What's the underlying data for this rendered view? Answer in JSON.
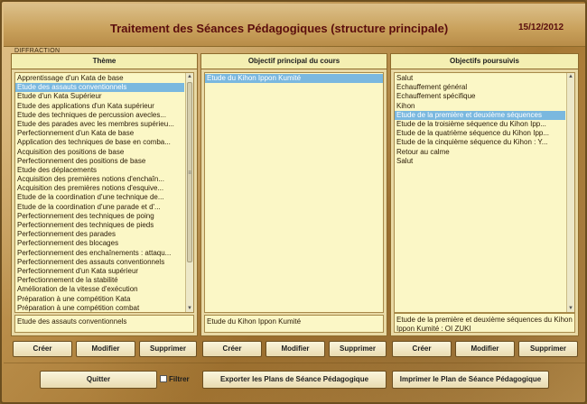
{
  "header": {
    "title": "Traitement des Séances Pédagogiques (structure principale)",
    "date": "15/12/2012",
    "section": "DIFFRACTION"
  },
  "panels": {
    "theme": {
      "header": "Thème",
      "items": [
        "Apprentissage d'un Kata de base",
        "Etude des assauts conventionnels",
        "Etude d'un Kata Supérieur",
        "Etude des applications d'un Kata supérieur",
        "Etude des techniques de percussion avecles...",
        "Etude des parades avec les membres supérieu...",
        "Perfectionnement d'un Kata de base",
        "Application des techniques de base en comba...",
        "Acquisition des positions de base",
        "Perfectionnement des positions de base",
        "Etude des déplacements",
        "Acquisition des premières notions d'enchaîn...",
        "Acquisition des premières notions d'esquive...",
        "Etude de la coordination d'une technique de...",
        "Etude de la coordination d'une parade et d'...",
        "Perfectionnement des techniques de poing",
        "Perfectionnement des techniques de pieds",
        "Perfectionnement des parades",
        "Perfectionnement des blocages",
        "Perfectionnement des enchaînements : attaqu...",
        "Perfectionnement des assauts conventionnels",
        "Perfectionnement d'un Kata supérieur",
        "Perfectionnement de la stabilité",
        "Amélioration de la vitesse d'exécution",
        "Préparation à une compétition Kata",
        "Préparation à une compétition combat"
      ],
      "selected_index": 1,
      "detail": "Etude des assauts conventionnels"
    },
    "objectif_principal": {
      "header": "Objectif principal du cours",
      "items": [
        "Etude du Kihon Ippon Kumité"
      ],
      "selected_index": 0,
      "detail": "Etude du Kihon Ippon Kumité"
    },
    "objectifs_poursuivis": {
      "header": "Objectifs poursuivis",
      "items": [
        "Salut",
        "Echauffement général",
        "Echauffement spécifique",
        "Kihon",
        "Etude de la première et deuxième séquences",
        "Etude de la troisième séquence du Kihon Ipp...",
        "Etude de la quatrième séquence du Kihon Ipp...",
        "Etude de la cinquième séquence du Kihon : Y...",
        "Retour au calme",
        "Salut"
      ],
      "selected_index": 4,
      "detail": "Etude de la première et deuxième séquences du Kihon Ippon Kumité : OI ZUKI"
    }
  },
  "buttons": {
    "create": "Créer",
    "modify": "Modifier",
    "delete": "Supprimer",
    "quit": "Quitter",
    "filter": "Filtrer",
    "export": "Exporter les Plans de Séance Pédagogique",
    "print": "Imprimer le Plan de Séance Pédagogique"
  },
  "scroll_glyphs": {
    "up": "▲",
    "down": "▼",
    "grip": "≡"
  },
  "colors": {
    "title_text": "#5a0d0d",
    "selection": "#7ab8df",
    "list_bg": "#fbf7c6",
    "header_bg": "#f4efb2"
  }
}
